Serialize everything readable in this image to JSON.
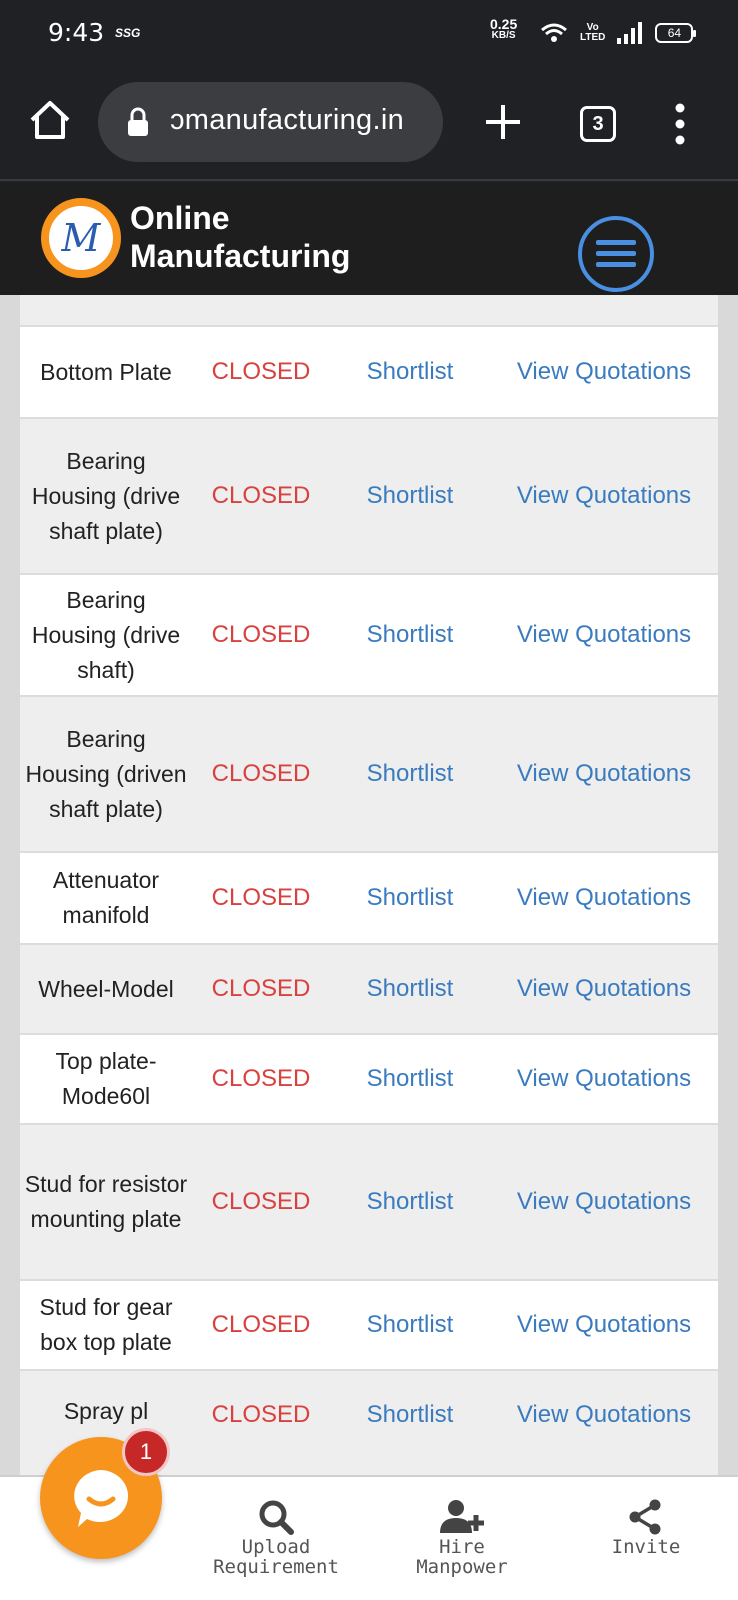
{
  "status_bar": {
    "time": "9:43",
    "extra": "SSG",
    "net_speed_value": "0.25",
    "net_speed_unit": "KB/S",
    "volte_top": "Vo",
    "volte_bottom": "LTED",
    "battery": "64"
  },
  "browser": {
    "url": "ɔmanufacturing.in",
    "tab_count": "3"
  },
  "site": {
    "brand_line1": "Online",
    "brand_line2": "Manufacturing",
    "accent_color": "#f7941d",
    "header_bg": "#1e1e1e"
  },
  "table": {
    "rows": [
      {
        "name": "Bottom Plate",
        "status": "CLOSED",
        "shortlist": "Shortlist",
        "view": "View Quotations"
      },
      {
        "name": "Bearing Housing (drive shaft plate)",
        "status": "CLOSED",
        "shortlist": "Shortlist",
        "view": "View Quotations"
      },
      {
        "name": "Bearing Housing (drive shaft)",
        "status": "CLOSED",
        "shortlist": "Shortlist",
        "view": "View Quotations"
      },
      {
        "name": "Bearing Housing (driven shaft plate)",
        "status": "CLOSED",
        "shortlist": "Shortlist",
        "view": "View Quotations"
      },
      {
        "name": "Attenuator manifold",
        "status": "CLOSED",
        "shortlist": "Shortlist",
        "view": "View Quotations"
      },
      {
        "name": "Wheel-Model",
        "status": "CLOSED",
        "shortlist": "Shortlist",
        "view": "View Quotations"
      },
      {
        "name": "Top plate-Mode60l",
        "status": "CLOSED",
        "shortlist": "Shortlist",
        "view": "View Quotations"
      },
      {
        "name": "Stud for resistor mounting plate",
        "status": "CLOSED",
        "shortlist": "Shortlist",
        "view": "View Quotations"
      },
      {
        "name": "Stud for gear box top plate",
        "status": "CLOSED",
        "shortlist": "Shortlist",
        "view": "View Quotations"
      },
      {
        "name": "Spray pl",
        "status": "CLOSED",
        "shortlist": "Shortlist",
        "view": "View Quotations"
      }
    ]
  },
  "bottom_nav": {
    "upload_line1": "Upload",
    "upload_line2": "Requirement",
    "hire_line1": "Hire",
    "hire_line2": "Manpower",
    "invite": "Invite"
  },
  "chat": {
    "badge_count": "1"
  }
}
